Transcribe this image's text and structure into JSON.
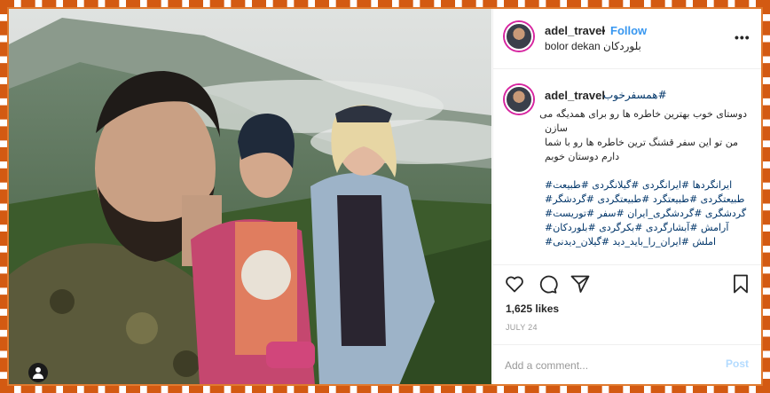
{
  "post": {
    "username": "adel_travel",
    "separator": "•",
    "follow_label": "Follow",
    "location": "bolor dekan بلوردکان",
    "more_label": "•••"
  },
  "caption": {
    "username": "adel_travel",
    "first_tag": "همسفرخوب#",
    "lines": [
      "دوستای خوب بهترین خاطره ها رو برای همدیگه می",
      "سازن",
      "من تو این سفر قشنگ ترین خاطره ها رو با شما",
      "دارم دوستان خوبم"
    ],
    "hashtag_lines": [
      "ایرانگردها #ایرانگردی #گیلانگردی #طبیعت#",
      "طبیعتگردی #طبیعتگرد #طبیعتگردی #گردشگر#",
      "گردشگری #گردشگری_ایران #سفر #توریست#",
      "آرامش #آبشارگردی #بکرگردی #بلوردکان#",
      "املش #ایران_را_باید_دید #گیلان_دیدنی#"
    ]
  },
  "actions": {
    "like_icon": "heart-icon",
    "comment_icon": "comment-icon",
    "share_icon": "share-icon",
    "save_icon": "bookmark-icon",
    "likes": "1,625 likes",
    "date": "JULY 24"
  },
  "comment_box": {
    "placeholder": "Add a comment...",
    "post_label": "Post"
  },
  "colors": {
    "frame": "#d35a12",
    "link": "#3897f0",
    "hashtag": "#003569"
  }
}
